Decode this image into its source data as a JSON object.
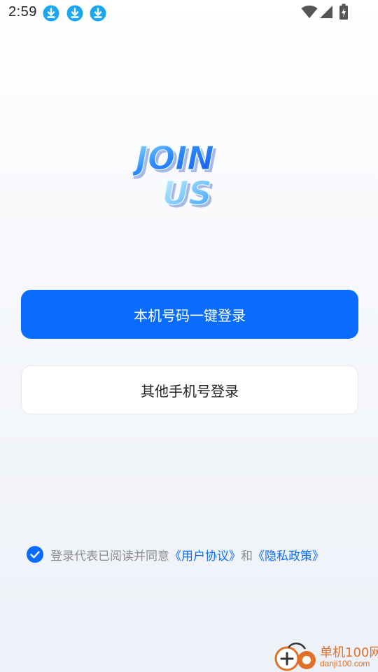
{
  "status_bar": {
    "time": "2:59",
    "icons": [
      "download-icon",
      "download-icon",
      "download-icon",
      "wifi-icon",
      "signal-icon",
      "battery-charging-icon"
    ]
  },
  "logo": {
    "lines": [
      "JOIN",
      "US"
    ]
  },
  "login": {
    "one_click_label": "本机号码一键登录",
    "other_phone_label": "其他手机号登录"
  },
  "agreement": {
    "checked": true,
    "prefix": "登录代表已阅读并同意",
    "user_agreement": "《用户协议》",
    "conjunction": "和",
    "privacy_policy": "《隐私政策》"
  },
  "watermark": {
    "name": "单机100网",
    "domain": "danji100.com"
  },
  "colors": {
    "accent": "#0a6cff",
    "secondary_text": "#8c8c8c",
    "watermark": "#e0702a"
  }
}
